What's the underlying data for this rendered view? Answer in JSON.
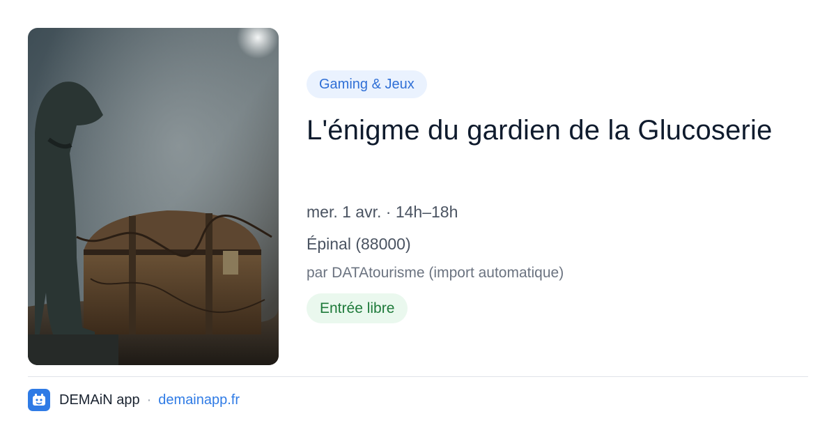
{
  "event": {
    "category": "Gaming & Jeux",
    "title": "L'énigme du gardien de la Glucoserie",
    "date_time": "mer. 1 avr. · 14h–18h",
    "location": "Épinal (88000)",
    "organizer": "par DATAtourisme (import automatique)",
    "price": "Entrée libre",
    "image": {
      "icon": "event-photo",
      "alt": "bronze dog statue beside an old wooden treasure chest in fog"
    }
  },
  "footer": {
    "app_name": "DEMAiN app",
    "separator": "·",
    "domain": "demainapp.fr",
    "logo_icon": "demain-logo-icon"
  },
  "colors": {
    "category_bg": "#eaf2fe",
    "category_text": "#2f6fd6",
    "price_bg": "#eaf8ee",
    "price_text": "#1e7a3a",
    "link": "#2f7be5",
    "title": "#0f1b2d"
  }
}
